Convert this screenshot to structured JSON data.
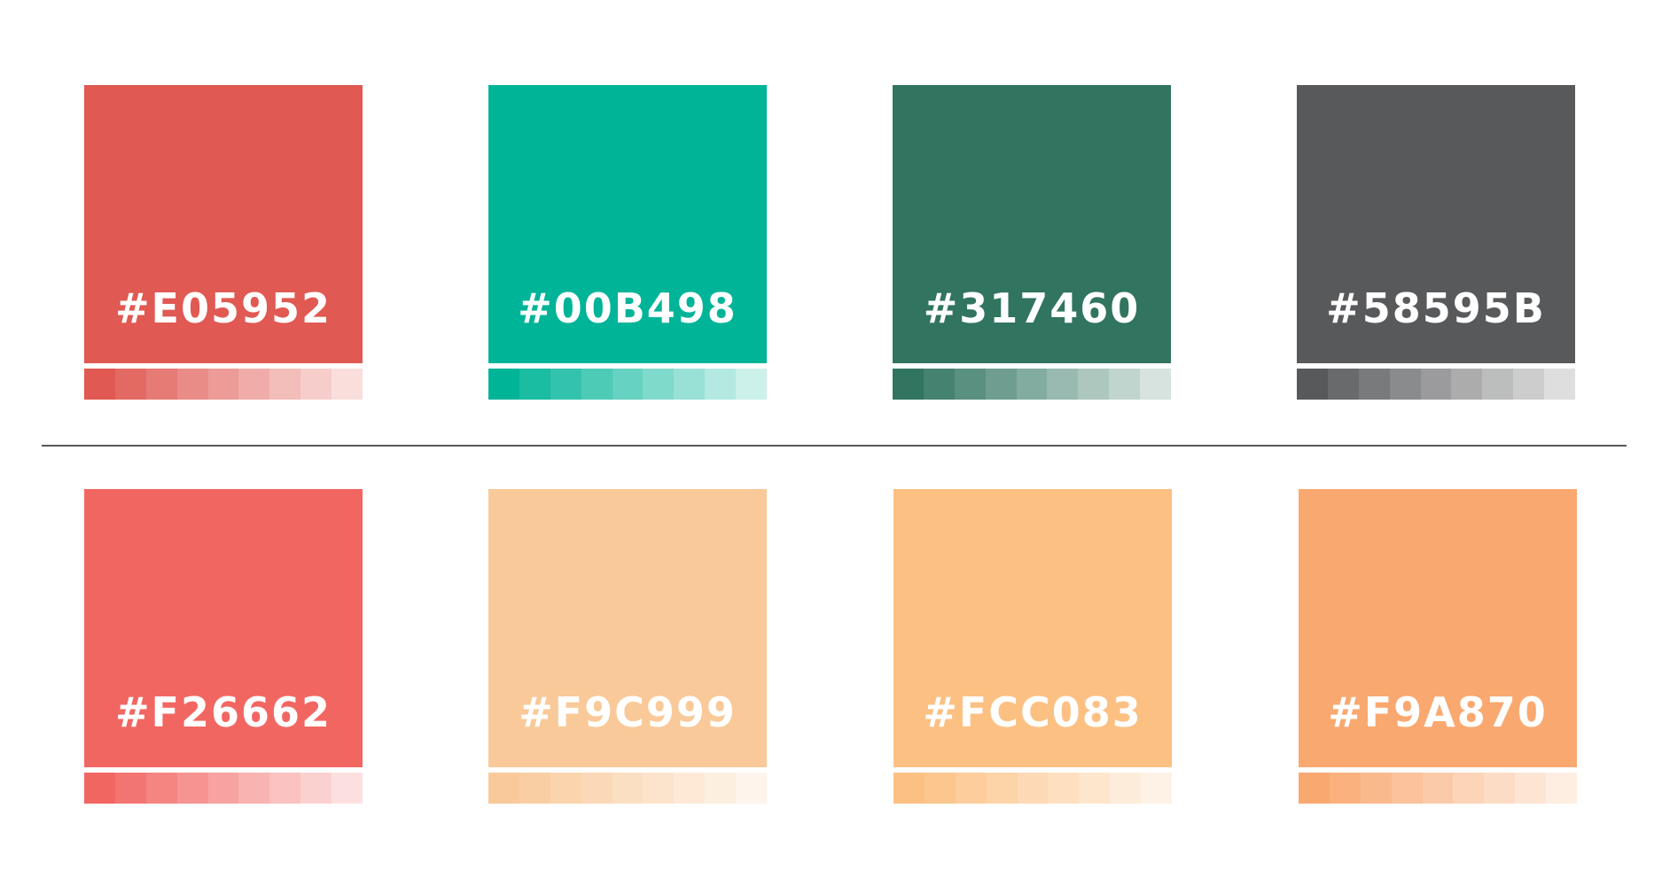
{
  "swatches": [
    {
      "label": "#E05952",
      "color": "#E05952"
    },
    {
      "label": "#00B498",
      "color": "#00B498"
    },
    {
      "label": "#317460",
      "color": "#317460"
    },
    {
      "label": "#58595B",
      "color": "#58595B"
    },
    {
      "label": "#F26662",
      "color": "#F26662"
    },
    {
      "label": "#F9C999",
      "color": "#F9C999"
    },
    {
      "label": "#FCC083",
      "color": "#FCC083"
    },
    {
      "label": "#F9A870",
      "color": "#F9A870"
    }
  ],
  "divider_color": "#58595B"
}
